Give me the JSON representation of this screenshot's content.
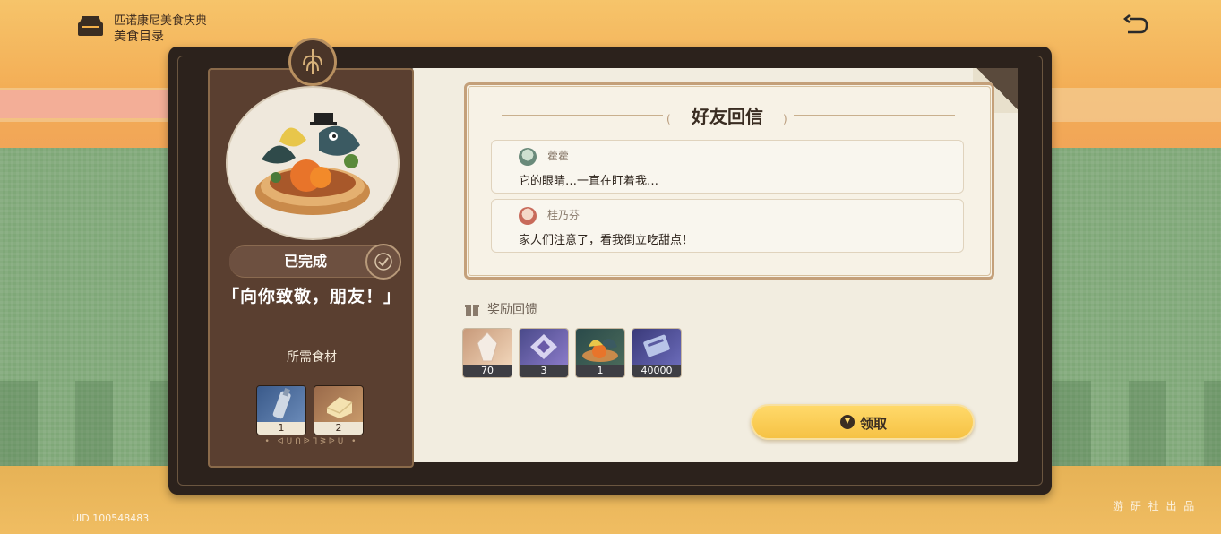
{
  "header": {
    "event_name": "匹诺康尼美食庆典",
    "page_title": "美食目录"
  },
  "dish": {
    "status": "已完成",
    "name": "「向你致敬，朋友！」",
    "ingredients_title": "所需食材",
    "ingredients": [
      {
        "count": "1",
        "icon": "ingredient-bottle-icon"
      },
      {
        "count": "2",
        "icon": "ingredient-butter-icon"
      }
    ]
  },
  "letter": {
    "title": "好友回信",
    "messages": [
      {
        "sender": "藿藿",
        "text": "它的眼睛…一直在盯着我…"
      },
      {
        "sender": "桂乃芬",
        "text": "家人们注意了，看我倒立吃甜点！"
      }
    ]
  },
  "rewards": {
    "label": "奖励回馈",
    "items": [
      {
        "count": "70",
        "icon": "stellar-jade-icon"
      },
      {
        "count": "3",
        "icon": "credential-icon"
      },
      {
        "count": "1",
        "icon": "dish-icon"
      },
      {
        "count": "40000",
        "icon": "credit-icon"
      }
    ]
  },
  "claim_button": "领取",
  "uid": "UID 100548483",
  "watermark": "游 研 社 出 品"
}
